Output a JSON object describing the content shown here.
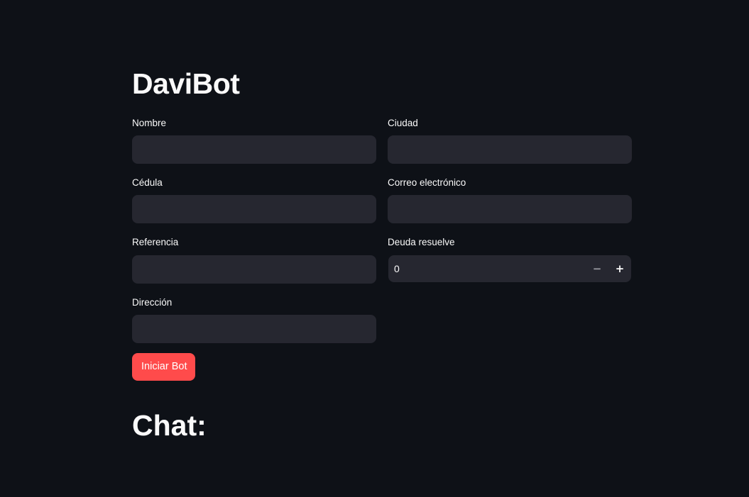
{
  "app": {
    "title": "DaviBot"
  },
  "form": {
    "nombre": {
      "label": "Nombre",
      "value": ""
    },
    "ciudad": {
      "label": "Ciudad",
      "value": ""
    },
    "cedula": {
      "label": "Cédula",
      "value": ""
    },
    "correo": {
      "label": "Correo electrónico",
      "value": ""
    },
    "referencia": {
      "label": "Referencia",
      "value": ""
    },
    "deuda": {
      "label": "Deuda resuelve",
      "value": "0",
      "decrement": "−",
      "increment": "+"
    },
    "direccion": {
      "label": "Dirección",
      "value": ""
    },
    "submit_label": "Iniciar Bot"
  },
  "chat": {
    "heading": "Chat:"
  },
  "colors": {
    "background": "#0e1117",
    "input_background": "#262730",
    "primary": "#ff4b4b",
    "text": "#fafafa"
  }
}
